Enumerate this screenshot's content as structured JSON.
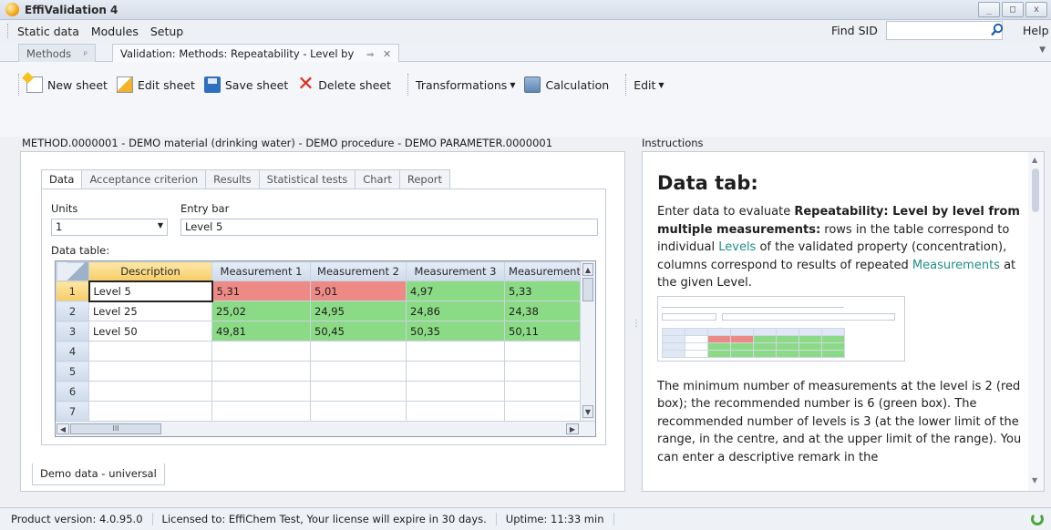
{
  "window": {
    "title": "EffiValidation 4",
    "min": "_",
    "max": "□",
    "close": "x"
  },
  "menu": {
    "items": [
      "Static data",
      "Modules",
      "Setup"
    ],
    "find_sid_label": "Find SID",
    "find_sid_value": "",
    "help": "Help"
  },
  "doc_tabs": {
    "methods": "Methods",
    "methods_pin": "ᵖ",
    "active": "Validation: Methods: Repeatability - Level by",
    "active_pin": "⇒",
    "active_close": "✕"
  },
  "toolbar": {
    "new_sheet": "New sheet",
    "edit_sheet": "Edit sheet",
    "save_sheet": "Save sheet",
    "delete_sheet": "Delete sheet",
    "transformations": "Transformations",
    "calculation": "Calculation",
    "edit": "Edit"
  },
  "path": "METHOD.0000001 - DEMO material (drinking water) - DEMO procedure - DEMO PARAMETER.0000001",
  "instructions_label": "Instructions",
  "subtabs": [
    "Data",
    "Acceptance criterion",
    "Results",
    "Statistical tests",
    "Chart",
    "Report"
  ],
  "data_tab": {
    "units_label": "Units",
    "units_value": "1",
    "entry_label": "Entry bar",
    "entry_value": "Level 5",
    "table_label": "Data table:",
    "columns": [
      "Description",
      "Measurement 1",
      "Measurement 2",
      "Measurement 3",
      "Measurement"
    ],
    "rows": [
      {
        "n": "1",
        "cells": [
          "Level 5",
          "5,31",
          "5,01",
          "4,97",
          "5,33"
        ]
      },
      {
        "n": "2",
        "cells": [
          "Level 25",
          "25,02",
          "24,95",
          "24,86",
          "24,38"
        ]
      },
      {
        "n": "3",
        "cells": [
          "Level 50",
          "49,81",
          "50,45",
          "50,35",
          "50,11"
        ]
      },
      {
        "n": "4",
        "cells": [
          "",
          "",
          "",
          "",
          ""
        ]
      },
      {
        "n": "5",
        "cells": [
          "",
          "",
          "",
          "",
          ""
        ]
      },
      {
        "n": "6",
        "cells": [
          "",
          "",
          "",
          "",
          ""
        ]
      },
      {
        "n": "7",
        "cells": [
          "",
          "",
          "",
          "",
          ""
        ]
      }
    ],
    "hscroll_grip": "III"
  },
  "bottom_tab": "Demo data - universal",
  "instructions": {
    "heading": "Data tab:",
    "p1_a": "Enter data to evaluate ",
    "p1_b": "Repeatability: Level by level from multiple measurements:",
    "p1_c": " rows in the table correspond to individual ",
    "p1_levels": "Levels",
    "p1_d": " of the validated property (concentration), columns correspond to results of repeated ",
    "p1_meas": "Measurements",
    "p1_e": " at the given Level.",
    "p2": "The minimum number of measurements at the level is 2 (red box); the recommended number is 6 (green box). The recommended number of levels is 3 (at the lower limit of the range, in the centre, and at the upper limit of the range). You can enter a descriptive remark in the"
  },
  "status": {
    "version": "Product version: 4.0.95.0",
    "license": "Licensed to: EffiChem Test, Your license will expire in 30 days.",
    "uptime": "Uptime: 11:33 min"
  }
}
